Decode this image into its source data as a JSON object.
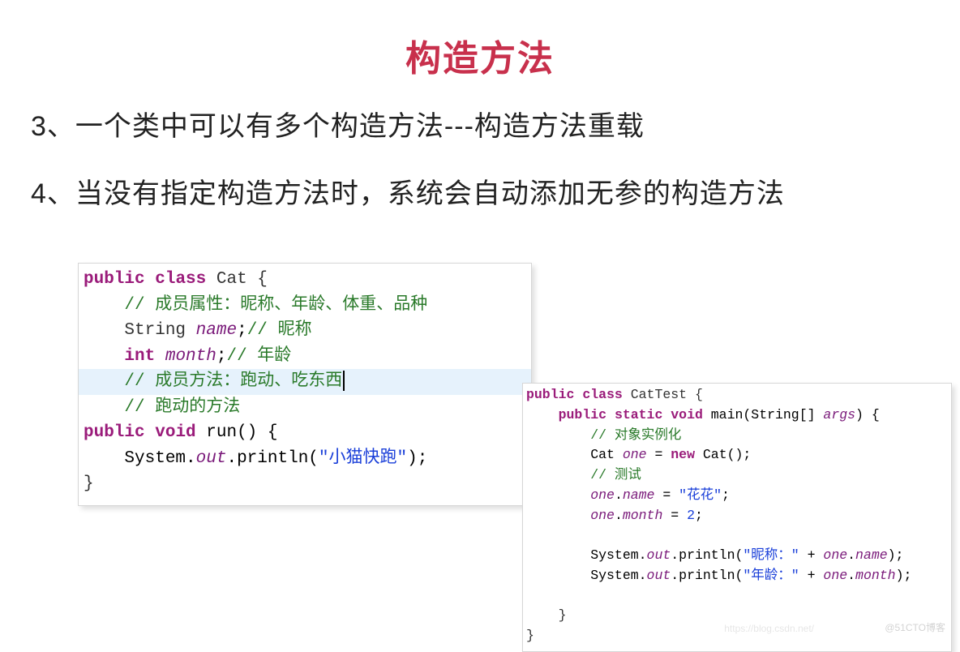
{
  "title": "构造方法",
  "bullets": {
    "b1_num": "3、",
    "b1_text": "一个类中可以有多个构造方法---构造方法重载",
    "b2_num": "4、",
    "b2_text": "当没有指定构造方法时，系统会自动添加无参的构造方法"
  },
  "code_left": {
    "kw_public": "public",
    "kw_class": "class",
    "classname": "Cat",
    "brace_open": "{",
    "comment1": "// 成员属性：昵称、年龄、体重、品种",
    "type_string": "String",
    "field_name": "name",
    "comment_name": "// 昵称",
    "type_int": "int",
    "field_month": "month",
    "comment_month": "// 年龄",
    "comment_methods": "// 成员方法：跑动、吃东西",
    "comment_run": "// 跑动的方法",
    "kw_void": "void",
    "method_run": "run",
    "sys": "System",
    "out": "out",
    "println": "println",
    "str_run": "\"小猫快跑\"",
    "brace_close": "}"
  },
  "code_right": {
    "kw_public": "public",
    "kw_class": "class",
    "classname": "CatTest",
    "brace_open": "{",
    "kw_static": "static",
    "kw_void": "void",
    "method_main": "main",
    "param_type": "String[]",
    "param_name": "args",
    "comment_inst": "// 对象实例化",
    "type_cat": "Cat",
    "var_one": "one",
    "kw_new": "new",
    "ctor": "Cat()",
    "comment_test": "// 测试",
    "assign_name_lhs": "one",
    "assign_name_field": "name",
    "str_hua": "\"花花\"",
    "assign_month_field": "month",
    "num_two": "2",
    "sys": "System",
    "out": "out",
    "println": "println",
    "str_nick": "\"昵称：\"",
    "str_age": "\"年龄：\"",
    "plus": "+",
    "brace_close": "}"
  },
  "watermark_main": "@51CTO博客",
  "watermark_faint": "https://blog.csdn.net/"
}
